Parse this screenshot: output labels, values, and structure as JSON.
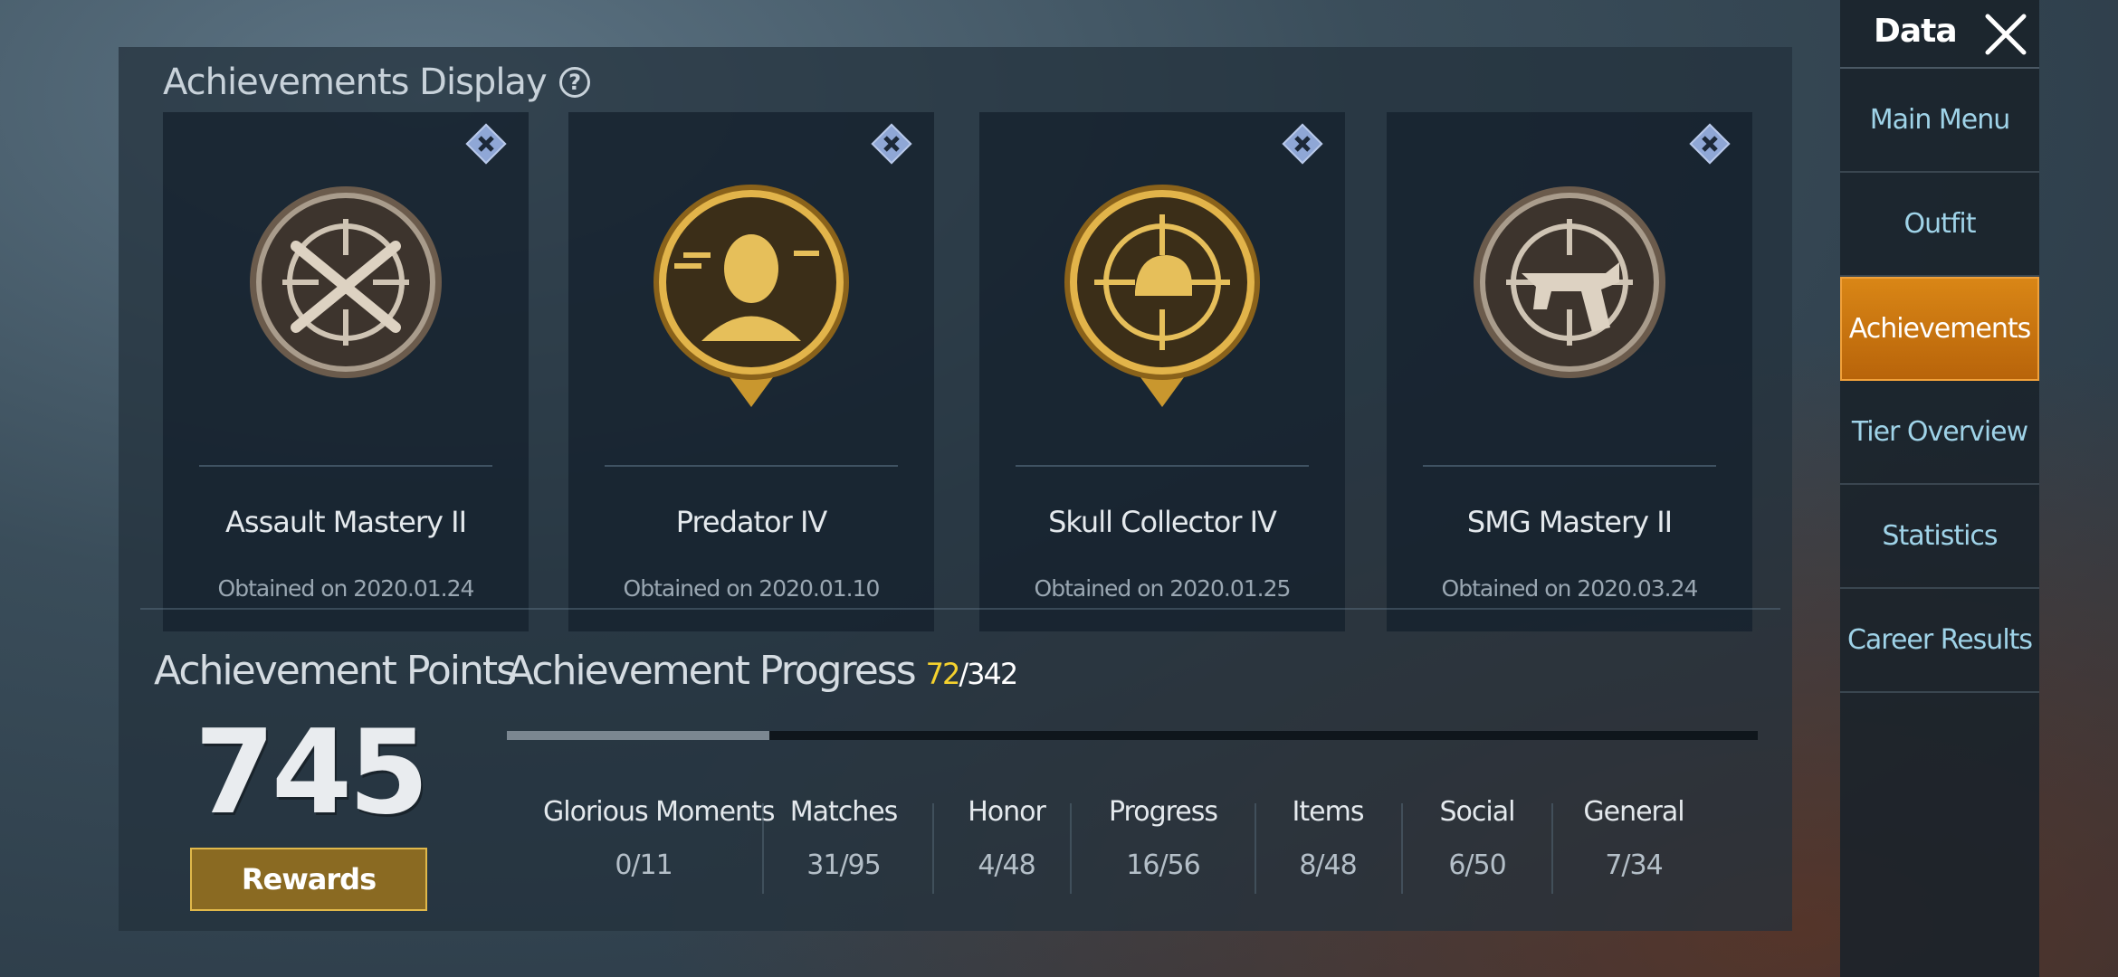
{
  "achievements_display": {
    "title": "Achievements Display",
    "help_icon": "question-circle-icon",
    "cards": [
      {
        "name": "Assault Mastery II",
        "date": "Obtained on 2020.01.24",
        "badge": "crossed-rifles-crosshair-icon",
        "tier": "silver"
      },
      {
        "name": "Predator IV",
        "date": "Obtained on 2020.01.10",
        "badge": "player-head-icon",
        "tier": "gold"
      },
      {
        "name": "Skull Collector IV",
        "date": "Obtained on 2020.01.25",
        "badge": "helmet-crosshair-icon",
        "tier": "gold"
      },
      {
        "name": "SMG Mastery II",
        "date": "Obtained on 2020.03.24",
        "badge": "smg-crosshair-icon",
        "tier": "silver"
      }
    ]
  },
  "points": {
    "label": "Achievement Points",
    "value": "745",
    "rewards_label": "Rewards"
  },
  "progress": {
    "title": "Achievement Progress",
    "current": "72",
    "total": "/342",
    "fraction": 0.21,
    "categories": [
      {
        "label": "Glorious Moments",
        "value": "0/11"
      },
      {
        "label": "Matches",
        "value": "31/95"
      },
      {
        "label": "Honor",
        "value": "4/48"
      },
      {
        "label": "Progress",
        "value": "16/56"
      },
      {
        "label": "Items",
        "value": "8/48"
      },
      {
        "label": "Social",
        "value": "6/50"
      },
      {
        "label": "General",
        "value": "7/34"
      }
    ]
  },
  "sidebar": {
    "title": "Data",
    "close_icon": "close-icon",
    "items": [
      {
        "label": "Main Menu"
      },
      {
        "label": "Outfit"
      },
      {
        "label": "Achievements",
        "active": true
      },
      {
        "label": "Tier Overview"
      },
      {
        "label": "Statistics"
      },
      {
        "label": "Career Results"
      }
    ]
  },
  "colors": {
    "accent_orange": "#d98616",
    "progress_current": "#f5d22e",
    "rewards_gold": "#8a6a22",
    "gold_badge": "#c9972e",
    "silver_badge": "#a99c8c"
  }
}
